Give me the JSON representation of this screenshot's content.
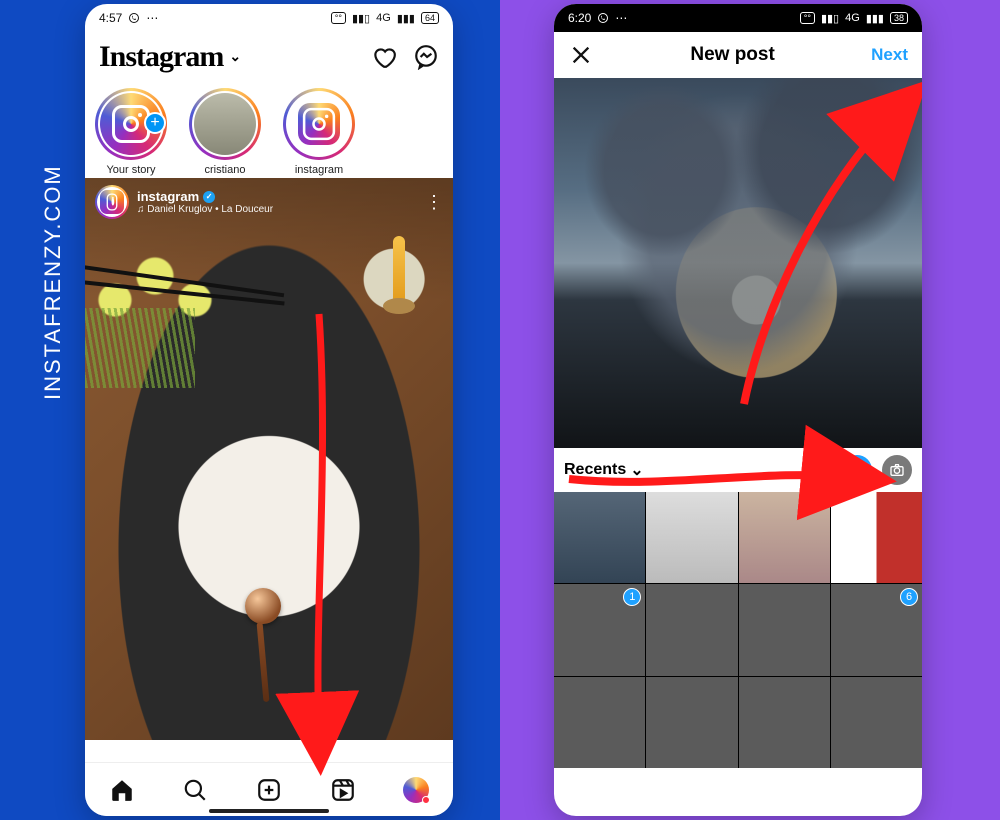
{
  "watermark": "INSTAFRENZY.COM",
  "left": {
    "status": {
      "time": "4:57",
      "network": "4G",
      "battery": "64"
    },
    "app_name": "Instagram",
    "stories": [
      {
        "label": "Your story"
      },
      {
        "label": "cristiano"
      },
      {
        "label": "instagram"
      }
    ],
    "post": {
      "user": "instagram",
      "music_prefix": "♫",
      "music": "Daniel Kruglov • La Douceur",
      "more": "⋮"
    },
    "tabs": [
      "home",
      "search",
      "create",
      "reels",
      "profile"
    ]
  },
  "right": {
    "status": {
      "time": "6:20",
      "network": "4G",
      "battery": "38"
    },
    "title": "New post",
    "next": "Next",
    "recents": "Recents",
    "sel": {
      "a": "1",
      "b": "6"
    }
  }
}
